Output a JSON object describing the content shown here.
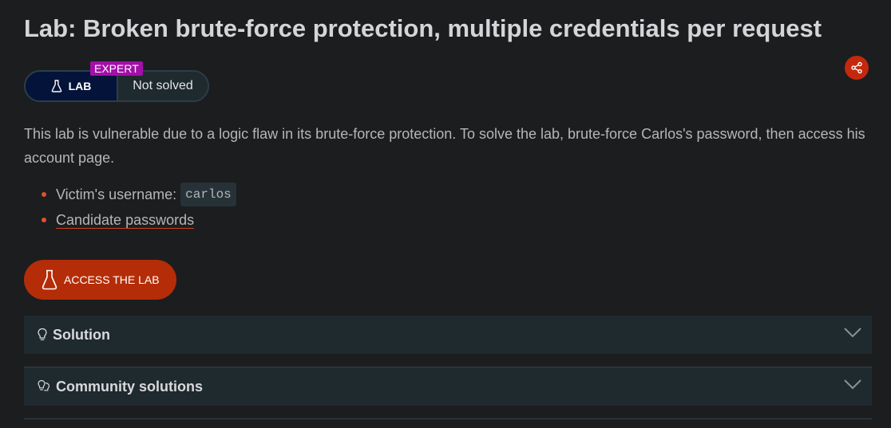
{
  "lab": {
    "title": "Lab: Broken brute-force protection, multiple credentials per request",
    "type_label": "LAB",
    "level": "EXPERT",
    "status": "Not solved",
    "description": "This lab is vulnerable due to a logic flaw in its brute-force protection. To solve the lab, brute-force Carlos's password, then access his account page.",
    "victim_label": "Victim's username:",
    "victim_username": "carlos",
    "candidate_passwords_link": "Candidate passwords",
    "access_button": "ACCESS THE LAB"
  },
  "accordions": {
    "solution": "Solution",
    "community": "Community solutions"
  },
  "colors": {
    "background": "#1c1d1f",
    "accent": "#b42d08",
    "level_badge": "#a30fa8",
    "lab_pill": "#04133a",
    "panel": "#1f2a2f"
  },
  "icons": [
    "flask-icon",
    "share-icon",
    "lightbulb-icon",
    "lightbulbs-icon",
    "chevron-down-icon"
  ]
}
